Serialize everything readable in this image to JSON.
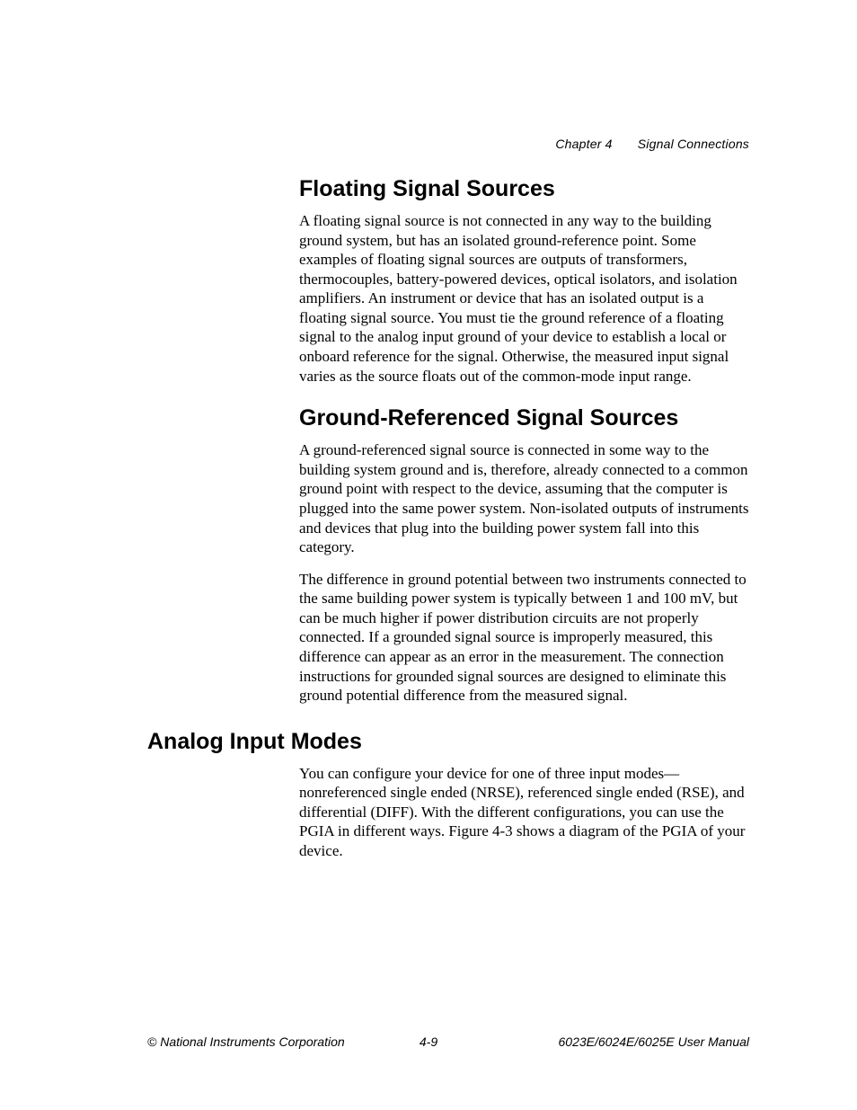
{
  "header": {
    "chapter": "Chapter 4",
    "title": "Signal Connections"
  },
  "sections": {
    "floating": {
      "heading": "Floating Signal Sources",
      "p1": "A floating signal source is not connected in any way to the building ground system, but has an isolated ground-reference point. Some examples of floating signal sources are outputs of transformers, thermocouples, battery-powered devices, optical isolators, and isolation amplifiers. An instrument or device that has an isolated output is a floating signal source. You must tie the ground reference of a floating signal to the analog input ground of your device to establish a local or onboard reference for the signal. Otherwise, the measured input signal varies as the source floats out of the common-mode input range."
    },
    "grounded": {
      "heading": "Ground-Referenced Signal Sources",
      "p1": "A ground-referenced signal source is connected in some way to the building system ground and is, therefore, already connected to a common ground point with respect to the device, assuming that the computer is plugged into the same power system. Non-isolated outputs of instruments and devices that plug into the building power system fall into this category.",
      "p2": "The difference in ground potential between two instruments connected to the same building power system is typically between 1 and 100 mV, but can be much higher if power distribution circuits are not properly connected. If a grounded signal source is improperly measured, this difference can appear as an error in the measurement. The connection instructions for grounded signal sources are designed to eliminate this ground potential difference from the measured signal."
    },
    "analog": {
      "heading": "Analog Input Modes",
      "p1": "You can configure your device for one of three input modes—nonreferenced single ended (NRSE), referenced single ended (RSE), and differential (DIFF). With the different configurations, you can use the PGIA in different ways. Figure 4-3 shows a diagram of the PGIA of your device."
    }
  },
  "footer": {
    "left": "© National Instruments Corporation",
    "center": "4-9",
    "right": "6023E/6024E/6025E User Manual"
  }
}
